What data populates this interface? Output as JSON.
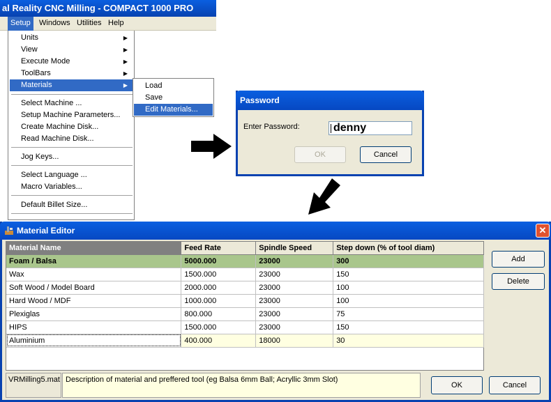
{
  "app": {
    "title": "al Reality CNC Milling  -  COMPACT 1000 PRO",
    "menubar": [
      "Setup",
      "Windows",
      "Utilities",
      "Help"
    ]
  },
  "setup_menu": {
    "items": [
      {
        "label": "Units",
        "submenu": true
      },
      {
        "label": "View",
        "submenu": true
      },
      {
        "label": "Execute Mode",
        "submenu": true
      },
      {
        "label": "ToolBars",
        "submenu": true
      },
      {
        "label": "Materials",
        "submenu": true
      },
      {
        "label": "Select Machine ...",
        "submenu": false
      },
      {
        "label": "Setup Machine Parameters...",
        "submenu": false
      },
      {
        "label": "Create Machine Disk...",
        "submenu": false
      },
      {
        "label": "Read Machine Disk...",
        "submenu": false
      },
      {
        "label": "Jog Keys...",
        "submenu": false
      },
      {
        "label": "Select Language ...",
        "submenu": false
      },
      {
        "label": "Macro Variables...",
        "submenu": false
      },
      {
        "label": "Default Billet Size...",
        "submenu": false
      }
    ],
    "arrow_glyph": "▶"
  },
  "materials_submenu": [
    "Load",
    "Save",
    "Edit Materials..."
  ],
  "password_dialog": {
    "title": "Password",
    "label": "Enter Password:",
    "value": "denny",
    "ok": "OK",
    "cancel": "Cancel"
  },
  "material_editor": {
    "title": "Material Editor",
    "close_glyph": "✕",
    "columns": [
      "Material Name",
      "Feed Rate",
      "Spindle Speed",
      "Step down (% of tool diam)"
    ],
    "rows": [
      [
        "Foam / Balsa",
        "5000.000",
        "23000",
        "300"
      ],
      [
        "Wax",
        "1500.000",
        "23000",
        "150"
      ],
      [
        "Soft Wood / Model Board",
        "2000.000",
        "23000",
        "100"
      ],
      [
        "Hard Wood / MDF",
        "1000.000",
        "23000",
        "100"
      ],
      [
        "Plexiglas",
        "800.000",
        "23000",
        "75"
      ],
      [
        "HIPS",
        "1500.000",
        "23000",
        "150"
      ],
      [
        "Aluminium",
        "400.000",
        "18000",
        "30"
      ]
    ],
    "add": "Add",
    "delete": "Delete",
    "file": "VRMilling5.mat",
    "description": "Description of material and preffered tool (eg Balsa 6mm Ball; Acryllic 3mm Slot)",
    "ok": "OK",
    "cancel": "Cancel"
  },
  "colors": {
    "titlebar": "#0842b0",
    "menu_highlight": "#316ac5",
    "row_highlight": "#a9c68c",
    "selected_row": "#ffffe1",
    "dialog_bg": "#ece9d8"
  }
}
